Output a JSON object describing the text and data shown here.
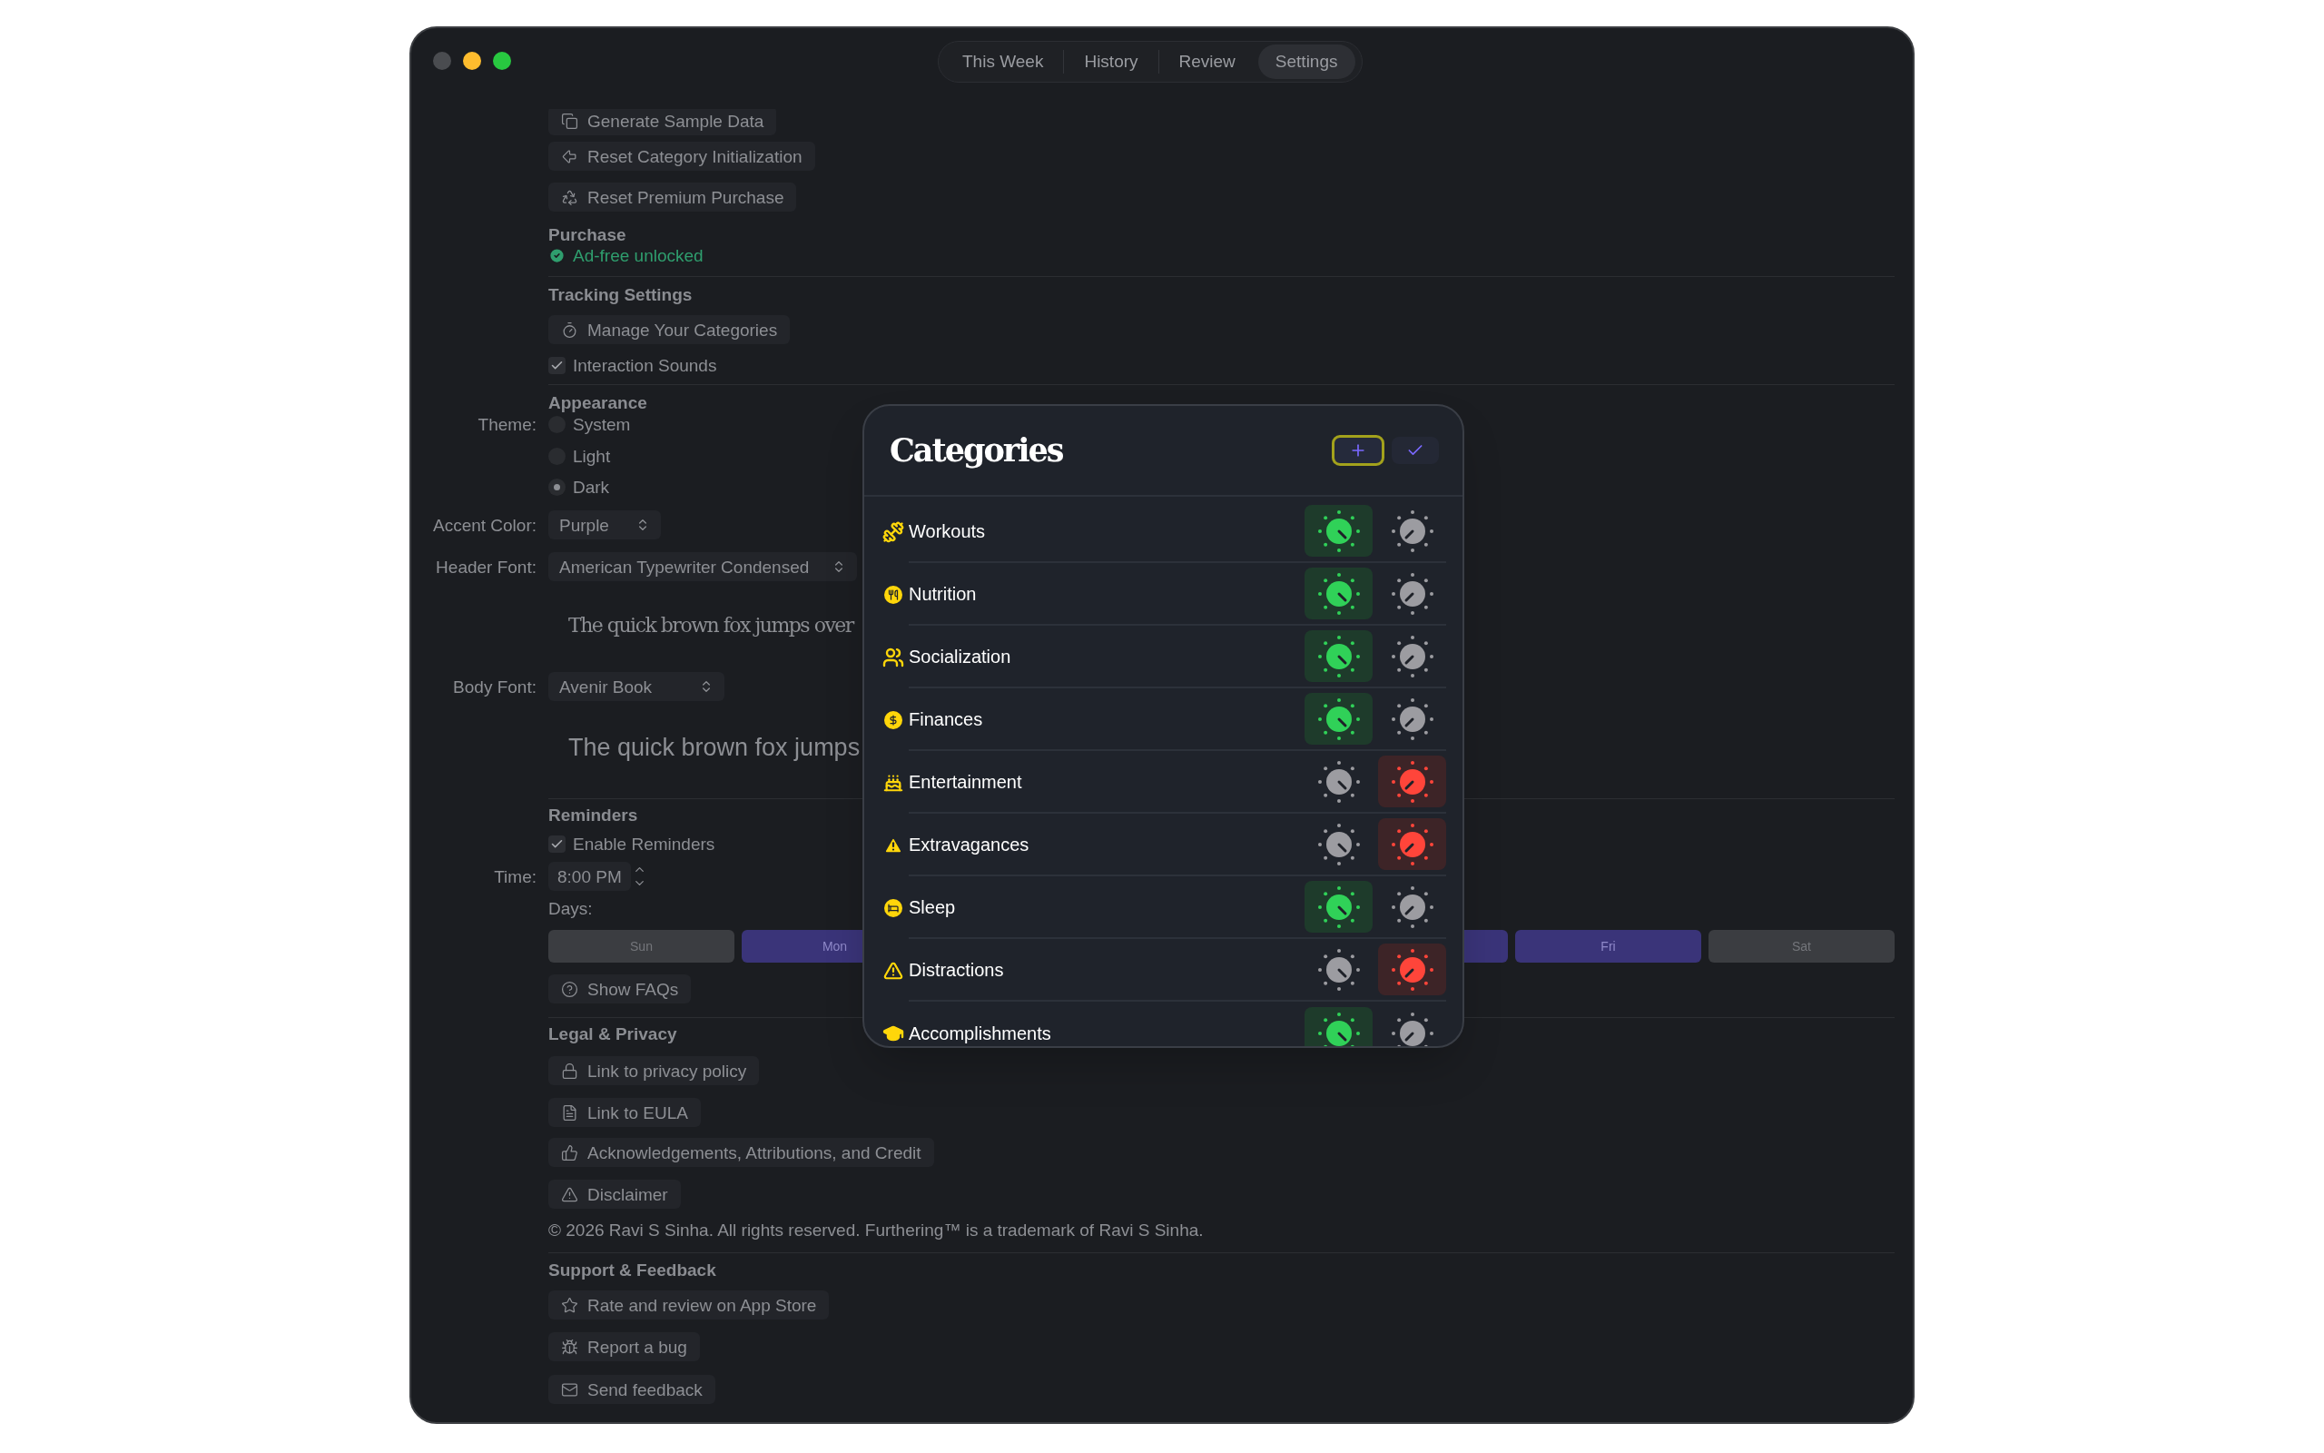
{
  "tabs": [
    {
      "label": "This Week",
      "selected": false
    },
    {
      "label": "History",
      "selected": false
    },
    {
      "label": "Review",
      "selected": false
    },
    {
      "label": "Settings",
      "selected": true
    }
  ],
  "settings": {
    "debug_buttons": [
      "Generate Sample Data",
      "Reset Category Initialization",
      "Reset Premium Purchase"
    ],
    "purchase": {
      "heading": "Purchase",
      "status": "Ad-free unlocked"
    },
    "tracking": {
      "heading": "Tracking Settings",
      "manage_button": "Manage Your Categories",
      "interaction_sounds": {
        "label": "Interaction Sounds",
        "checked": true
      }
    },
    "appearance": {
      "heading": "Appearance",
      "theme_label": "Theme:",
      "themes": [
        {
          "label": "System",
          "selected": false
        },
        {
          "label": "Light",
          "selected": false
        },
        {
          "label": "Dark",
          "selected": true
        }
      ],
      "accent_label": "Accent Color:",
      "accent_value": "Purple",
      "header_font_label": "Header Font:",
      "header_font_value": "American Typewriter Condensed",
      "header_sample": "The quick brown fox jumps over",
      "body_font_label": "Body Font:",
      "body_font_value": "Avenir Book",
      "body_sample": "The quick brown fox jumps"
    },
    "reminders": {
      "heading": "Reminders",
      "enable": {
        "label": "Enable Reminders",
        "checked": true
      },
      "time_label": "Time:",
      "time_value": "8:00 PM",
      "days_label": "Days:",
      "days": [
        {
          "label": "Sun",
          "selected": false
        },
        {
          "label": "Mon",
          "selected": true
        },
        {
          "selected": true
        },
        {
          "label": "Fri",
          "selected": true
        },
        {
          "label": "Sat",
          "selected": false
        }
      ]
    },
    "faq_button": "Show FAQs",
    "legal": {
      "heading": "Legal & Privacy",
      "links": [
        "Link to privacy policy",
        "Link to EULA",
        "Acknowledgements, Attributions, and Credit",
        "Disclaimer"
      ],
      "copyright": "© 2026 Ravi S Sinha. All rights reserved. Furthering™ is a trademark of Ravi S Sinha."
    },
    "support": {
      "heading": "Support & Feedback",
      "links": [
        "Rate and review on App Store",
        "Report a bug",
        "Send feedback"
      ]
    }
  },
  "categories_sheet": {
    "title": "Categories",
    "rows": [
      {
        "label": "Workouts",
        "positive": true
      },
      {
        "label": "Nutrition",
        "positive": true
      },
      {
        "label": "Socialization",
        "positive": true
      },
      {
        "label": "Finances",
        "positive": true
      },
      {
        "label": "Entertainment",
        "positive": false
      },
      {
        "label": "Extravagances",
        "positive": false
      },
      {
        "label": "Sleep",
        "positive": true
      },
      {
        "label": "Distractions",
        "positive": false
      },
      {
        "label": "Accomplishments",
        "positive": true
      }
    ]
  }
}
